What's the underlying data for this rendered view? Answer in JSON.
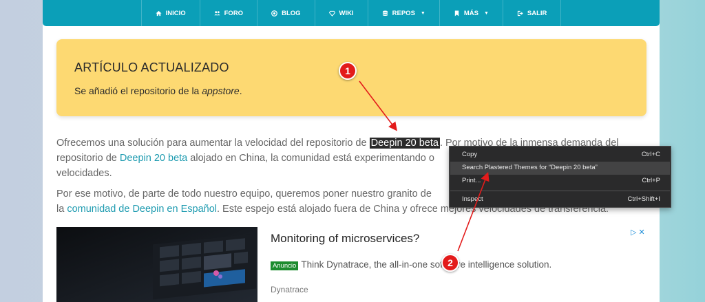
{
  "nav": {
    "items": [
      {
        "label": "INICIO",
        "icon": "home-icon"
      },
      {
        "label": "FORO",
        "icon": "users-icon"
      },
      {
        "label": "BLOG",
        "icon": "record-icon"
      },
      {
        "label": "WIKI",
        "icon": "diamond-icon"
      },
      {
        "label": "REPOS",
        "icon": "database-icon",
        "dropdown": true
      },
      {
        "label": "MÁS",
        "icon": "bookmark-icon",
        "dropdown": true
      },
      {
        "label": "SALIR",
        "icon": "sign-out-icon"
      }
    ]
  },
  "alert": {
    "title": "ARTÍCULO ACTUALIZADO",
    "text_before": "Se añadió el repositorio de la ",
    "text_em": "appstore",
    "text_after": "."
  },
  "paragraph1": {
    "l1_a": "Ofrecemos una solución para aumentar la velocidad del repositorio de ",
    "l1_selected": "Deepin 20 beta",
    "l1_b": ". Por motivo de la inmensa demanda del",
    "l2_a": "repositorio de ",
    "l2_link": "Deepin 20 beta",
    "l2_b": " alojado en China, la comunidad está experimentando o",
    "l3": "velocidades."
  },
  "paragraph2": {
    "l1": "Por ese motivo, de parte de todo nuestro equipo, queremos poner nuestro granito de",
    "l2_a": "la ",
    "l2_link": "comunidad de Deepin en Español",
    "l2_b": ". Este espejo está alojado fuera de China y ofrece mejores velocidades de transferencia."
  },
  "ad": {
    "headline": "Monitoring of microservices?",
    "badge": "Anuncio",
    "text": "Think Dynatrace, the all-in-one software intelligence solution.",
    "brand": "Dynatrace",
    "choices": "▷ ✕"
  },
  "context_menu": {
    "items": [
      {
        "label": "Copy",
        "shortcut": "Ctrl+C"
      },
      {
        "label": "Search Plastered Themes for “Deepin 20 beta”",
        "shortcut": ""
      },
      {
        "label": "Print...",
        "shortcut": "Ctrl+P"
      },
      {
        "label": "Inspect",
        "shortcut": "Ctrl+Shift+I"
      }
    ]
  },
  "markers": [
    "1",
    "2"
  ],
  "colors": {
    "nav": "#0b9fb8",
    "alert": "#fdd972",
    "link": "#1e9bb0",
    "marker": "#e31b1b"
  }
}
